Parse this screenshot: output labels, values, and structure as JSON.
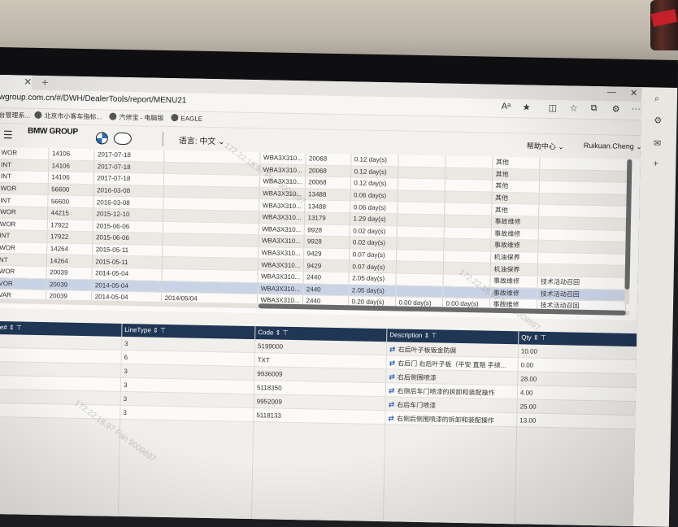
{
  "browser": {
    "url": "wgroup.com.cn/#/DWH/DealerTools/report/MENU21",
    "favorites": [
      "台管理系...",
      "北京市小客车指标...",
      "汽修宝 - 电脑版",
      "EAGLE"
    ]
  },
  "header": {
    "logo": "BMW GROUP",
    "language": "语言: 中文",
    "help": "帮助中心",
    "user": "Ruikuan.Cheng"
  },
  "upper_rows": [
    [
      "WOR",
      "14106",
      "2017-07-18",
      "",
      "WBA3X310...",
      "20068",
      "0.12 day(s)",
      "",
      "",
      "其他",
      ""
    ],
    [
      "INT",
      "14106",
      "2017-07-18",
      "",
      "WBA3X310...",
      "20068",
      "0.12 day(s)",
      "",
      "",
      "其他",
      ""
    ],
    [
      "INT",
      "14106",
      "2017-07-18",
      "",
      "WBA3X310...",
      "20068",
      "0.12 day(s)",
      "",
      "",
      "其他",
      ""
    ],
    [
      "WOR",
      "56600",
      "2016-03-08",
      "",
      "WBA3X310...",
      "13488",
      "0.06 day(s)",
      "",
      "",
      "其他",
      ""
    ],
    [
      "INT",
      "56600",
      "2016-03-08",
      "",
      "WBA3X310...",
      "13488",
      "0.06 day(s)",
      "",
      "",
      "其他",
      ""
    ],
    [
      "WOR",
      "44215",
      "2015-12-10",
      "",
      "WBA3X310...",
      "13179",
      "1.29 day(s)",
      "",
      "",
      "事故维修",
      ""
    ],
    [
      "WOR",
      "17922",
      "2015-06-06",
      "",
      "WBA3X310...",
      "9928",
      "0.02 day(s)",
      "",
      "",
      "事故维修",
      ""
    ],
    [
      "INT",
      "17922",
      "2015-06-06",
      "",
      "WBA3X310...",
      "9928",
      "0.02 day(s)",
      "",
      "",
      "事故维修",
      ""
    ],
    [
      "WOR",
      "14264",
      "2015-05-11",
      "",
      "WBA3X310...",
      "9429",
      "0.07 day(s)",
      "",
      "",
      "机油保养",
      ""
    ],
    [
      "NT",
      "14264",
      "2015-05-11",
      "",
      "WBA3X310...",
      "9429",
      "0.07 day(s)",
      "",
      "",
      "机油保养",
      ""
    ],
    [
      "WOR",
      "20039",
      "2014-05-04",
      "",
      "WBA3X310...",
      "2440",
      "2.05 day(s)",
      "",
      "",
      "事故维修",
      "技术活动召回"
    ],
    [
      "VOR",
      "20039",
      "2014-05-04",
      "",
      "WBA3X310...",
      "2440",
      "2.05 day(s)",
      "",
      "",
      "事故维修",
      "技术活动召回"
    ],
    [
      "VAR",
      "20039",
      "2014-05-04",
      "2014/05/04",
      "WBA3X310...",
      "2440",
      "0.20 day(s)",
      "0.00 day(s)",
      "0.00 day(s)",
      "事故维修",
      "技术活动召回"
    ]
  ],
  "lower_headers": [
    "ne#",
    "LineType",
    "Code",
    "Description",
    "Qty"
  ],
  "lower_rows": [
    {
      "line_type": "3",
      "code": "5199000",
      "desc": "右后叶子板钣金防腐",
      "qty": "10.00"
    },
    {
      "line_type": "6",
      "code": "TXT",
      "desc": "右后门 右后叶子板（平安 直赔 手续...",
      "qty": "0.00"
    },
    {
      "line_type": "3",
      "code": "9936009",
      "desc": "右后侧围喷漆",
      "qty": "28.00"
    },
    {
      "line_type": "3",
      "code": "5118350",
      "desc": "右侧后车门喷漆的拆卸和装配操作",
      "qty": "4.00"
    },
    {
      "line_type": "3",
      "code": "9952009",
      "desc": "右后车门喷漆",
      "qty": "25.00"
    },
    {
      "line_type": "3",
      "code": "5118133",
      "desc": "右侧后侧围喷漆的拆卸和装配操作",
      "qty": "13.00"
    }
  ],
  "watermark": "172.22.18.97 Pan 9009897"
}
